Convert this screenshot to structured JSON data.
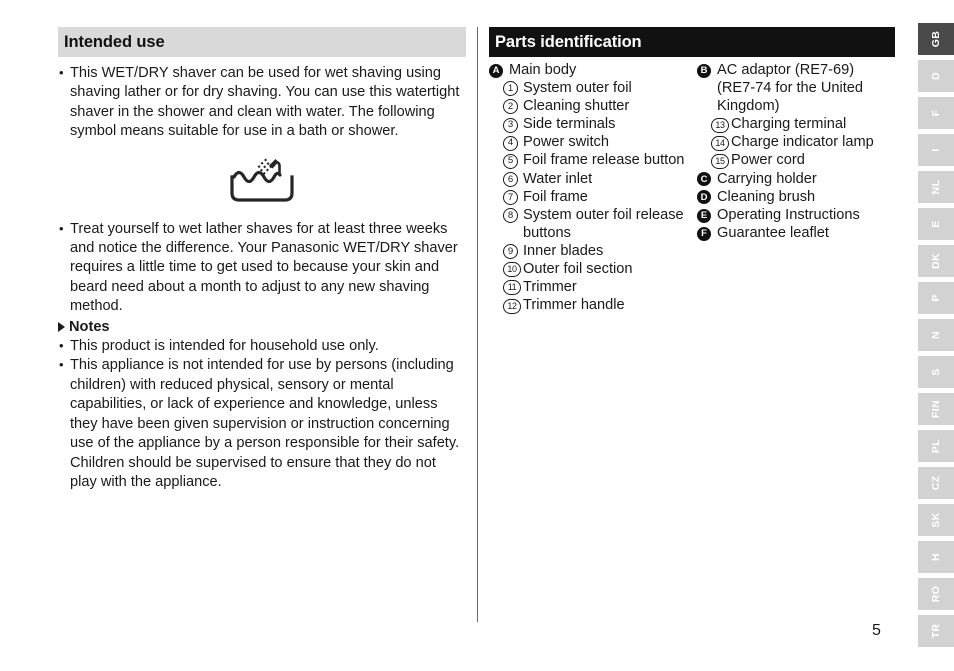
{
  "page_number": "5",
  "left_section": {
    "heading": "Intended use",
    "paragraphs": [
      "This WET/DRY shaver can be used for wet shaving using shaving lather or for dry shaving. You can use this watertight shaver in the shower and clean with water. The following symbol means suitable for use in a bath or shower.",
      "Treat yourself to wet lather shaves for at least three weeks and notice the difference. Your Panasonic WET/DRY shaver requires a little time to get used to because your skin and beard need about a month to adjust to any new shaving method."
    ],
    "symbol": {
      "name": "bath-shower-symbol",
      "description": "Bathtub with water and shower head"
    },
    "notes_heading": "Notes",
    "notes": [
      "This product is intended for household use only.",
      "This appliance is not intended for use by persons (including children) with reduced physical, sensory or mental capabilities, or lack of experience and knowledge, unless they have been given supervision or instruction concerning use of the appliance by a person responsible for their safety. Children should be supervised to ensure that they do not play with the appliance."
    ]
  },
  "right_section": {
    "heading": "Parts identification",
    "column_a": [
      {
        "marker": "A",
        "marker_type": "letter",
        "label": "Main body",
        "indent": false
      },
      {
        "marker": "1",
        "marker_type": "number",
        "label": "System outer foil",
        "indent": true
      },
      {
        "marker": "2",
        "marker_type": "number",
        "label": "Cleaning shutter",
        "indent": true
      },
      {
        "marker": "3",
        "marker_type": "number",
        "label": "Side terminals",
        "indent": true
      },
      {
        "marker": "4",
        "marker_type": "number",
        "label": "Power switch",
        "indent": true
      },
      {
        "marker": "5",
        "marker_type": "number",
        "label": "Foil frame release button",
        "indent": true
      },
      {
        "marker": "6",
        "marker_type": "number",
        "label": "Water inlet",
        "indent": true
      },
      {
        "marker": "7",
        "marker_type": "number",
        "label": "Foil frame",
        "indent": true
      },
      {
        "marker": "8",
        "marker_type": "number",
        "label": "System outer foil release",
        "indent": true
      },
      {
        "marker": "",
        "marker_type": "none",
        "label": "buttons",
        "indent": true
      },
      {
        "marker": "9",
        "marker_type": "number",
        "label": "Inner blades",
        "indent": true
      },
      {
        "marker": "10",
        "marker_type": "number",
        "label": "Outer foil section",
        "indent": true
      },
      {
        "marker": "11",
        "marker_type": "number",
        "label": "Trimmer",
        "indent": true
      },
      {
        "marker": "12",
        "marker_type": "number",
        "label": "Trimmer handle",
        "indent": true
      }
    ],
    "column_b": [
      {
        "marker": "B",
        "marker_type": "letter",
        "label": "AC adaptor (RE7-69)",
        "indent": false
      },
      {
        "marker": "",
        "marker_type": "none",
        "label": "(RE7-74 for the United",
        "indent": false
      },
      {
        "marker": "",
        "marker_type": "none",
        "label": "Kingdom)",
        "indent": false
      },
      {
        "marker": "13",
        "marker_type": "number",
        "label": "Charging terminal",
        "indent": true
      },
      {
        "marker": "14",
        "marker_type": "number",
        "label": "Charge indicator lamp",
        "indent": true
      },
      {
        "marker": "15",
        "marker_type": "number",
        "label": "Power cord",
        "indent": true
      },
      {
        "marker": "C",
        "marker_type": "letter",
        "label": "Carrying holder",
        "indent": false
      },
      {
        "marker": "D",
        "marker_type": "letter",
        "label": "Cleaning brush",
        "indent": false
      },
      {
        "marker": "E",
        "marker_type": "letter",
        "label": "Operating Instructions",
        "indent": false
      },
      {
        "marker": "F",
        "marker_type": "letter",
        "label": "Guarantee leaflet",
        "indent": false
      }
    ]
  },
  "language_tabs": {
    "active": "GB",
    "items": [
      "GB",
      "D",
      "F",
      "I",
      "NL",
      "E",
      "DK",
      "P",
      "N",
      "S",
      "FIN",
      "PL",
      "CZ",
      "SK",
      "H",
      "RO",
      "TR"
    ]
  },
  "colors": {
    "header_gray": "#d9d9d9",
    "header_black": "#111111",
    "tab_inactive": "#d2d2d2",
    "tab_active": "#4a4a4a",
    "divider": "#6b6b6b",
    "text": "#1a1a1a"
  }
}
